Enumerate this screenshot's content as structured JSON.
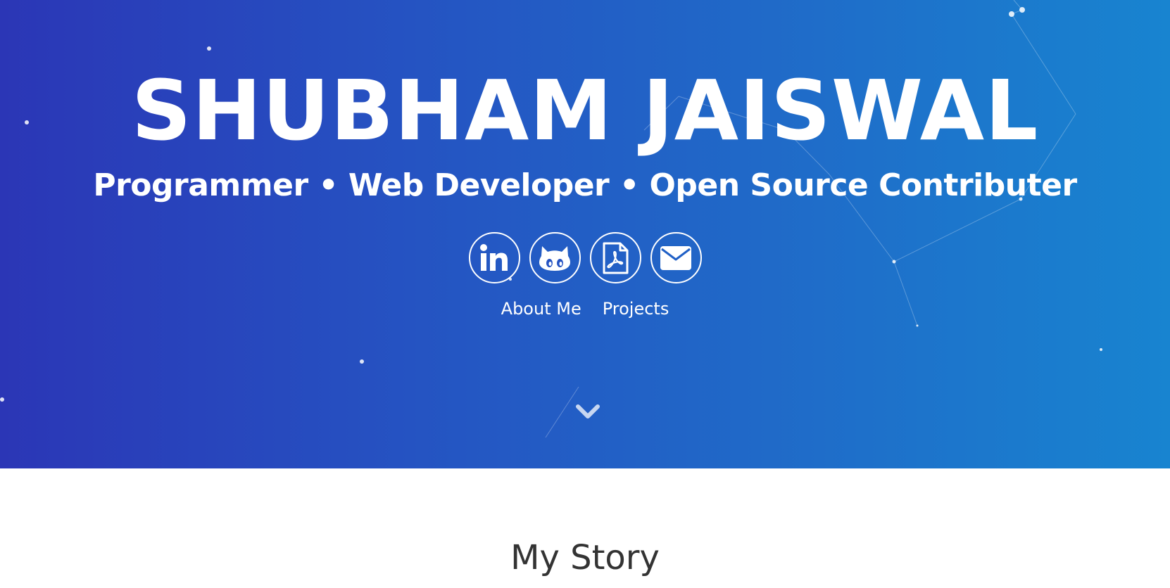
{
  "hero": {
    "name": "SHUBHAM JAISWAL",
    "tagline": "Programmer • Web Developer • Open Source Contributer",
    "gradient_colors": [
      "#2b36b6",
      "#1884d0"
    ],
    "socials": [
      {
        "icon": "linkedin-icon"
      },
      {
        "icon": "github-icon"
      },
      {
        "icon": "pdf-icon"
      },
      {
        "icon": "mail-icon"
      }
    ],
    "nav": {
      "about_label": "About Me",
      "projects_label": "Projects"
    },
    "scroll_icon": "chevron-down-icon"
  },
  "story": {
    "heading": "My Story"
  }
}
